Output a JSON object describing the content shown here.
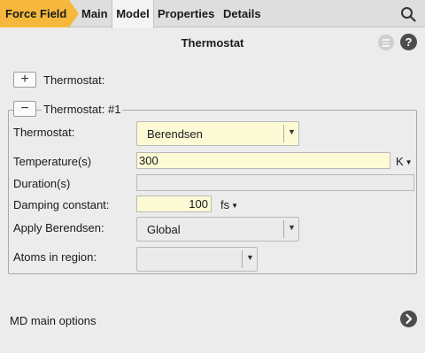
{
  "tabs": {
    "force_field": "Force Field",
    "main": "Main",
    "model": "Model",
    "properties": "Properties",
    "details": "Details"
  },
  "panel": {
    "title": "Thermostat",
    "help_symbol": "?"
  },
  "add_row": {
    "button_symbol": "+",
    "label": "Thermostat:"
  },
  "group": {
    "collapse_symbol": "−",
    "label": "Thermostat: #1",
    "thermostat": {
      "label": "Thermostat:",
      "value": "Berendsen"
    },
    "temperature": {
      "label": "Temperature(s)",
      "value": "300",
      "unit": "K"
    },
    "duration": {
      "label": "Duration(s)",
      "value": ""
    },
    "damping": {
      "label": "Damping constant:",
      "value": "100",
      "unit": "fs"
    },
    "apply": {
      "label": "Apply Berendsen:",
      "value": "Global"
    },
    "atoms_region": {
      "label": "Atoms in region:",
      "value": ""
    }
  },
  "md_options": {
    "label": "MD main options"
  },
  "colors": {
    "accent_tab": "#f6b83c",
    "input_highlight": "#fcfbd6",
    "icon_dark": "#4d4d4d"
  },
  "icons": [
    "search-icon",
    "menu-icon",
    "help-icon",
    "plus-icon",
    "minus-icon",
    "chevron-down-icon",
    "chevron-right-icon"
  ]
}
